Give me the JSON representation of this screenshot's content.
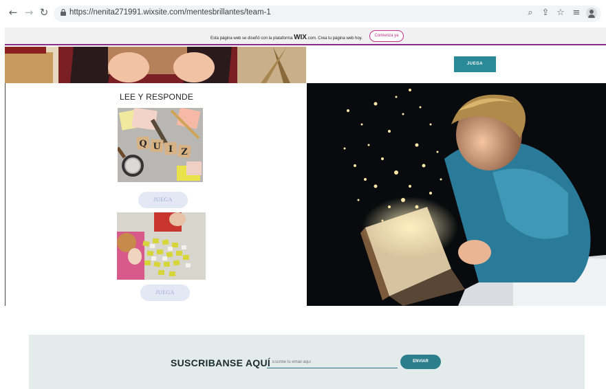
{
  "browser": {
    "url": "https://nenita271991.wixsite.com/mentesbrillantes/team-1",
    "back_icon": "arrow-left-icon",
    "forward_icon": "arrow-right-icon",
    "reload_icon": "reload-icon"
  },
  "wix_banner": {
    "text_before": "Esta página web se diseñó con la plataforma ",
    "brand": "WIX",
    "text_after": ".com. Crea tu página web hoy.",
    "button": "Comienza ya"
  },
  "sections": {
    "right_top_button": "JUEGA",
    "left_title": "LEE Y RESPONDE",
    "quiz_tiles": [
      "Q",
      "U",
      "I",
      "Z"
    ],
    "quiz_button": "JUEGA",
    "memory_button": "JUEGA"
  },
  "subscribe": {
    "title": "SUSCRIBANSE AQUÍ",
    "placeholder": "Escribe tu email aquí",
    "button": "ENVIAR"
  },
  "colors": {
    "accent_teal": "#2b8a98",
    "wix_purple": "#8a2a8a",
    "light_button": "#e3e8f5",
    "subscribe_bg": "#e3eceb"
  }
}
